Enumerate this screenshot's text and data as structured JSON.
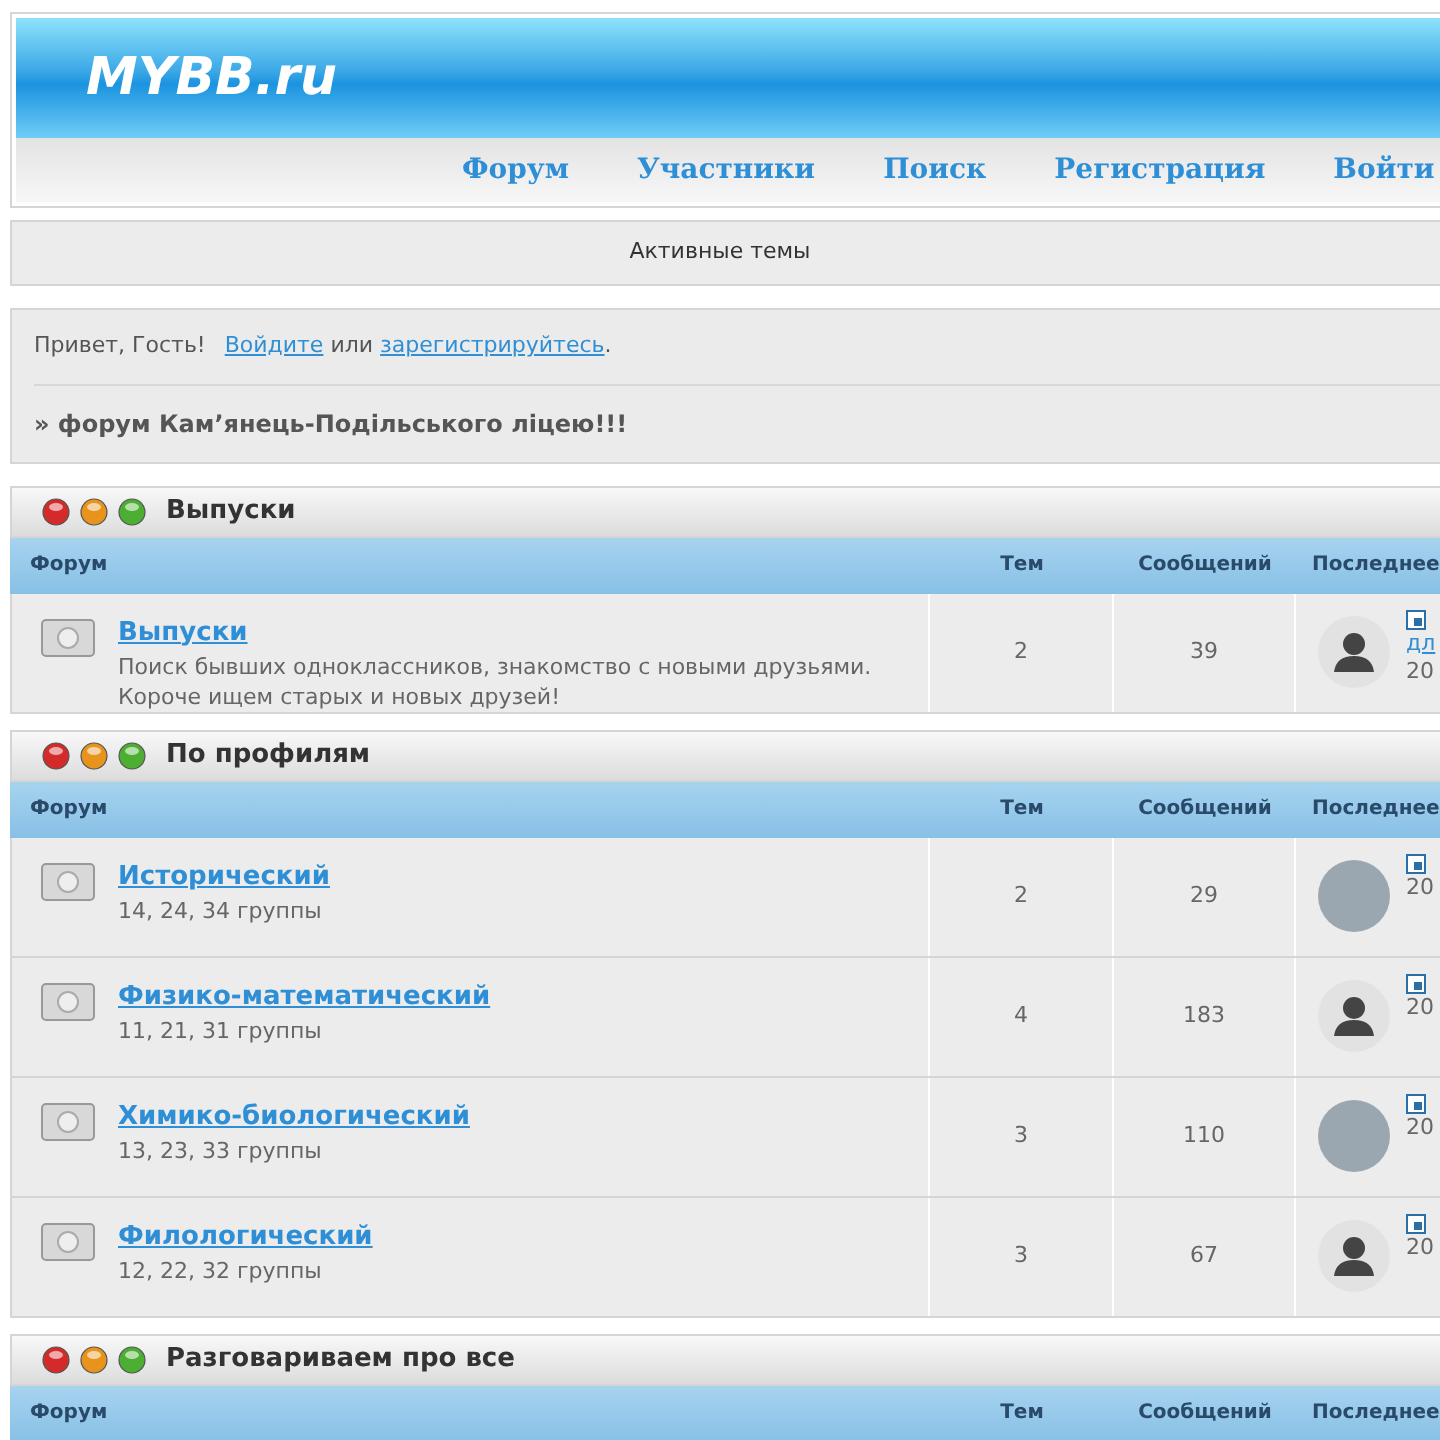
{
  "logo": "MYBB.ru",
  "nav": [
    "Форум",
    "Участники",
    "Поиск",
    "Регистрация",
    "Войти"
  ],
  "active_topics": "Активные темы",
  "greeting": {
    "text": "Привет, Гость!",
    "login_link": "Войдите",
    "or": "или",
    "register_link": "зарегистрируйтесь",
    "end": "."
  },
  "forum_title": "» форум Кам’янець-Подільського ліцею!!!",
  "categories": [
    {
      "title": "Выпуски",
      "columns": [
        "Форум",
        "Тем",
        "Сообщений",
        "Последнее"
      ],
      "rows": [
        {
          "name": "Выпуски",
          "desc": "Поиск бывших одноклассников, знакомство с новыми друзьями. Короче ищем старых и новых друзей!",
          "topics": "2",
          "posts": "39",
          "kind": "silhouette",
          "last_link": "дл",
          "last_date": "20"
        }
      ]
    },
    {
      "title": "По профилям",
      "columns": [
        "Форум",
        "Тем",
        "Сообщений",
        "Последнее"
      ],
      "rows": [
        {
          "name": "Исторический",
          "desc": "14, 24, 34 группы",
          "topics": "2",
          "posts": "29",
          "kind": "photo",
          "last_date": "20"
        },
        {
          "name": "Физико-математический",
          "desc": "11, 21, 31 группы",
          "topics": "4",
          "posts": "183",
          "kind": "silhouette",
          "last_date": "20"
        },
        {
          "name": "Химико-биологический",
          "desc": "13, 23, 33 группы",
          "topics": "3",
          "posts": "110",
          "kind": "photo",
          "last_date": "20"
        },
        {
          "name": "Филологический",
          "desc": "12, 22, 32 группы",
          "topics": "3",
          "posts": "67",
          "kind": "silhouette",
          "last_date": "20"
        }
      ]
    },
    {
      "title": "Разговариваем про все",
      "columns": [
        "Форум",
        "Тем",
        "Сообщений",
        "Последнее"
      ]
    }
  ]
}
